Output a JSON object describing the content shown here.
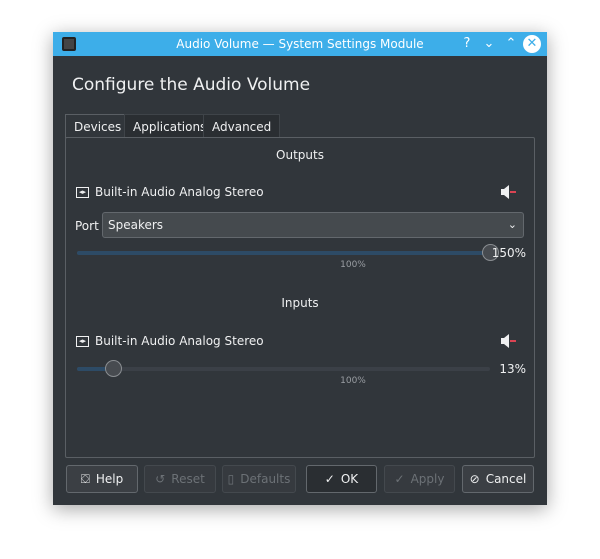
{
  "window": {
    "title": "Audio Volume — System Settings Module",
    "controls": [
      "?",
      "⌄",
      "⌃",
      "✕"
    ]
  },
  "heading": "Configure the Audio Volume",
  "tabs": [
    {
      "label": "Devices",
      "active": true
    },
    {
      "label": "Applications"
    },
    {
      "label": "Advanced"
    }
  ],
  "outputs": {
    "section": "Outputs",
    "device": "Built-in Audio Analog Stereo",
    "port_label": "Port",
    "port_value": "Speakers",
    "volume_percent": 150,
    "volume_text": "150%",
    "mark": "100%",
    "muted": true
  },
  "inputs": {
    "section": "Inputs",
    "device": "Built-in Audio Analog Stereo",
    "volume_percent": 13,
    "volume_text": "13%",
    "mark": "100%",
    "muted": true
  },
  "buttons": {
    "help": "Help",
    "reset": "Reset",
    "defaults": "Defaults",
    "ok": "OK",
    "apply": "Apply",
    "cancel": "Cancel"
  },
  "colors": {
    "accent": "#3daee9",
    "background": "#31363b",
    "mute": "#da4453"
  }
}
